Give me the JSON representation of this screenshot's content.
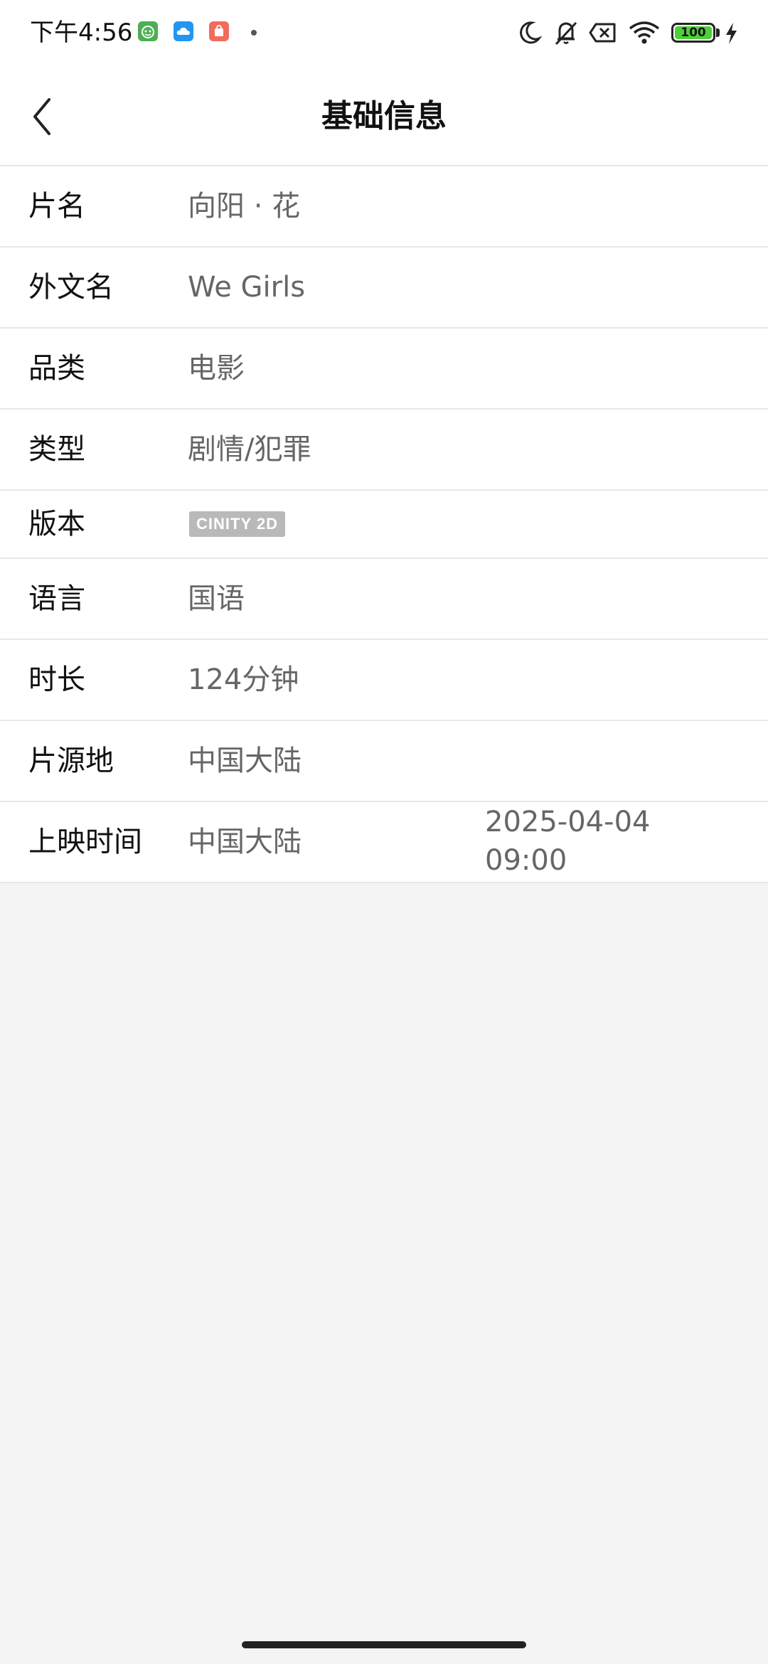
{
  "status_bar": {
    "time": "下午4:56",
    "notification_icons": [
      "android-face-icon",
      "cloud-icon",
      "shopping-bag-icon"
    ],
    "system_icons": [
      "moon-icon",
      "bell-off-icon",
      "no-sim-icon",
      "wifi-icon",
      "battery-icon",
      "charging-bolt-icon"
    ],
    "battery_level": "100",
    "battery_fill_percent": 100,
    "colors": {
      "android_face": "#4caf50",
      "cloud": "#2196f3",
      "shopping_bag": "#f26b5b",
      "battery_fill": "#4cd137"
    }
  },
  "header": {
    "title": "基础信息",
    "back_icon": "chevron-left-icon"
  },
  "info": {
    "rows": [
      {
        "label": "片名",
        "value": "向阳 · 花"
      },
      {
        "label": "外文名",
        "value": "We Girls"
      },
      {
        "label": "品类",
        "value": "电影"
      },
      {
        "label": "类型",
        "value": "剧情/犯罪"
      },
      {
        "label": "版本",
        "value": "CINITY 2D"
      },
      {
        "label": "语言",
        "value": "国语"
      },
      {
        "label": "时长",
        "value": "124分钟"
      },
      {
        "label": "片源地",
        "value": "中国大陆"
      },
      {
        "label": "上映时间",
        "value": "中国大陆",
        "date": "2025-04-04",
        "time": "09:00"
      }
    ]
  }
}
